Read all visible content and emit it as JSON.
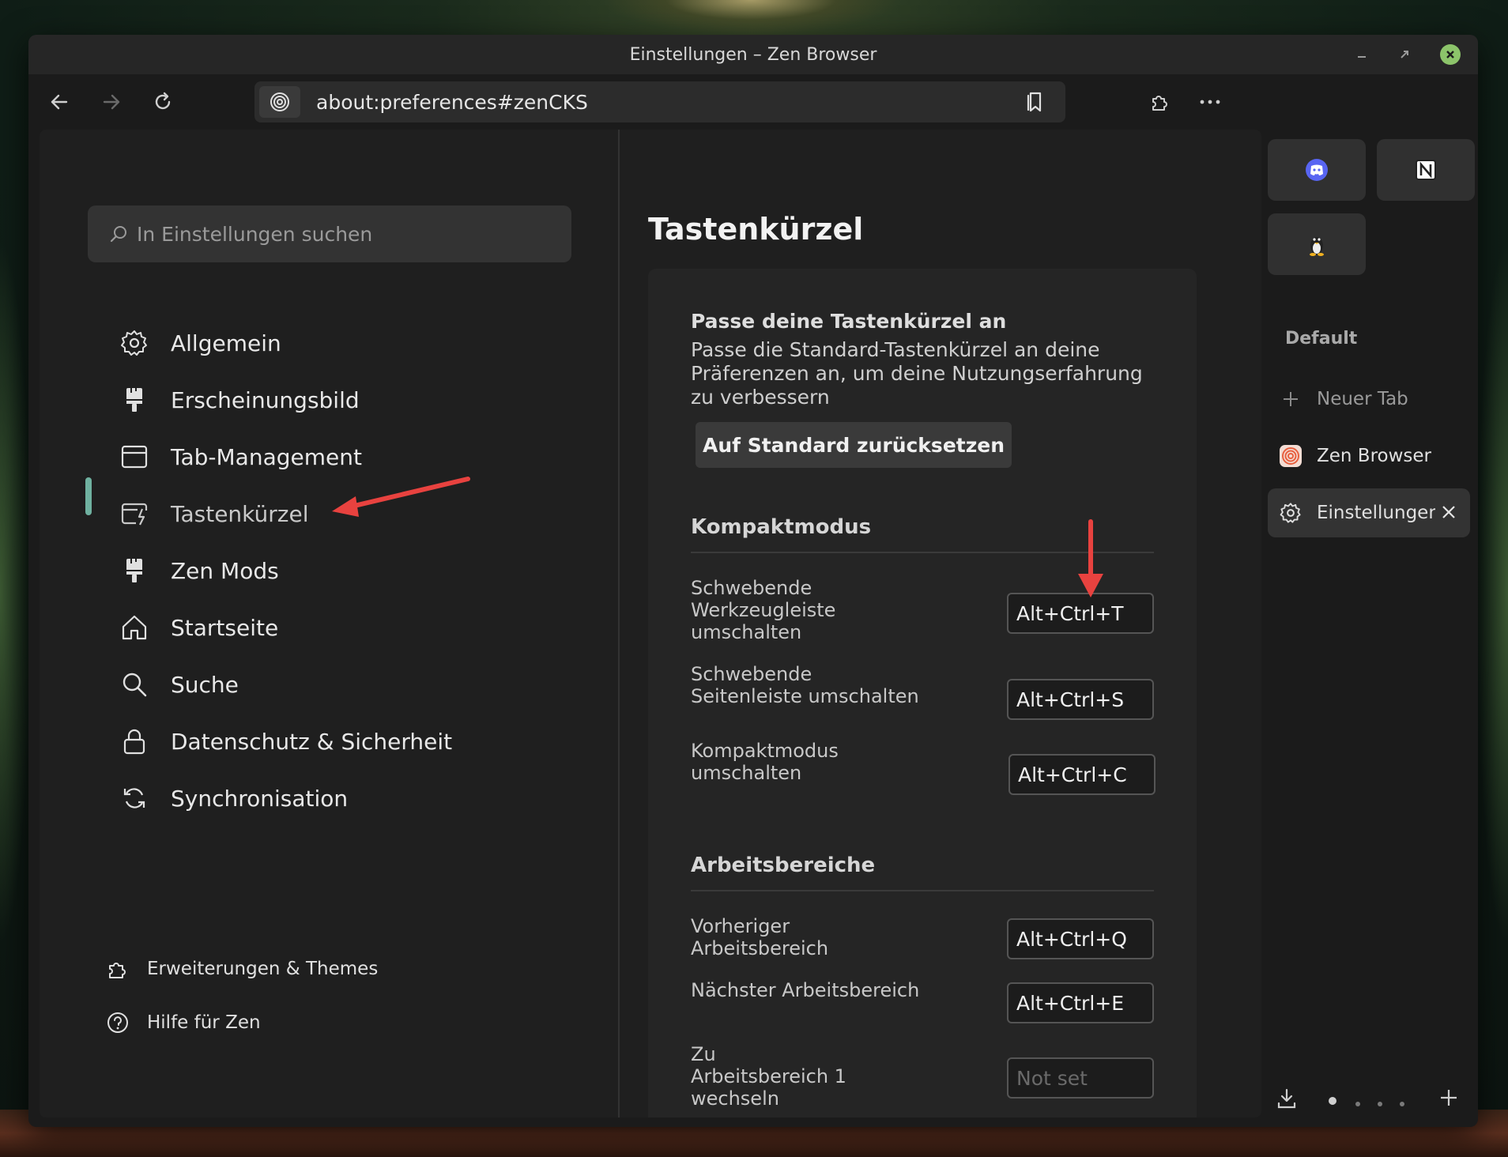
{
  "window": {
    "title": "Einstellungen – Zen Browser"
  },
  "toolbar": {
    "url": "about:preferences#zenCKS"
  },
  "search": {
    "placeholder": "In Einstellungen suchen"
  },
  "nav": {
    "items": [
      {
        "label": "Allgemein",
        "icon": "gear-icon"
      },
      {
        "label": "Erscheinungsbild",
        "icon": "paintbrush-icon"
      },
      {
        "label": "Tab-Management",
        "icon": "window-icon"
      },
      {
        "label": "Tastenkürzel",
        "icon": "keyboard-shortcut-icon",
        "active": true
      },
      {
        "label": "Zen Mods",
        "icon": "paintbrush-icon"
      },
      {
        "label": "Startseite",
        "icon": "home-icon"
      },
      {
        "label": "Suche",
        "icon": "search-icon"
      },
      {
        "label": "Datenschutz & Sicherheit",
        "icon": "lock-icon"
      },
      {
        "label": "Synchronisation",
        "icon": "sync-icon"
      }
    ],
    "footer": [
      {
        "label": "Erweiterungen & Themes",
        "icon": "puzzle-icon"
      },
      {
        "label": "Hilfe für Zen",
        "icon": "help-icon"
      }
    ]
  },
  "main": {
    "title": "Tastenkürzel",
    "card": {
      "heading": "Passe deine Tastenkürzel an",
      "description": "Passe die Standard-Tastenkürzel an deine Präferenzen an, um deine Nutzungserfahrung zu verbessern",
      "reset_label": "Auf Standard zurücksetzen"
    },
    "sections": [
      {
        "title": "Kompaktmodus",
        "rows": [
          {
            "label": "Schwebende Werkzeugleiste umschalten",
            "key": "Alt+Ctrl+T"
          },
          {
            "label": "Schwebende Seitenleiste umschalten",
            "key": "Alt+Ctrl+S"
          },
          {
            "label": "Kompaktmodus umschalten",
            "key": "Alt+Ctrl+C"
          }
        ]
      },
      {
        "title": "Arbeitsbereiche",
        "rows": [
          {
            "label": "Vorheriger Arbeitsbereich",
            "key": "Alt+Ctrl+Q"
          },
          {
            "label": "Nächster Arbeitsbereich",
            "key": "Alt+Ctrl+E"
          },
          {
            "label": "Zu Arbeitsbereich 1 wechseln",
            "key": "",
            "placeholder": "Not set"
          }
        ]
      }
    ]
  },
  "sidebar": {
    "essentials": [
      {
        "icon": "discord-icon"
      },
      {
        "icon": "notion-icon"
      },
      {
        "icon": "linux-penguin-icon"
      }
    ],
    "workspace": "Default",
    "new_tab_label": "Neuer Tab",
    "tabs": [
      {
        "label": "Zen Browser",
        "icon": "zen-logo-icon"
      },
      {
        "label": "Einstellungen",
        "icon": "gear-icon",
        "selected": true
      }
    ]
  },
  "colors": {
    "accent": "#6fb1a0",
    "annotation_arrow": "#e8423f",
    "close_button": "#8cc46a"
  }
}
